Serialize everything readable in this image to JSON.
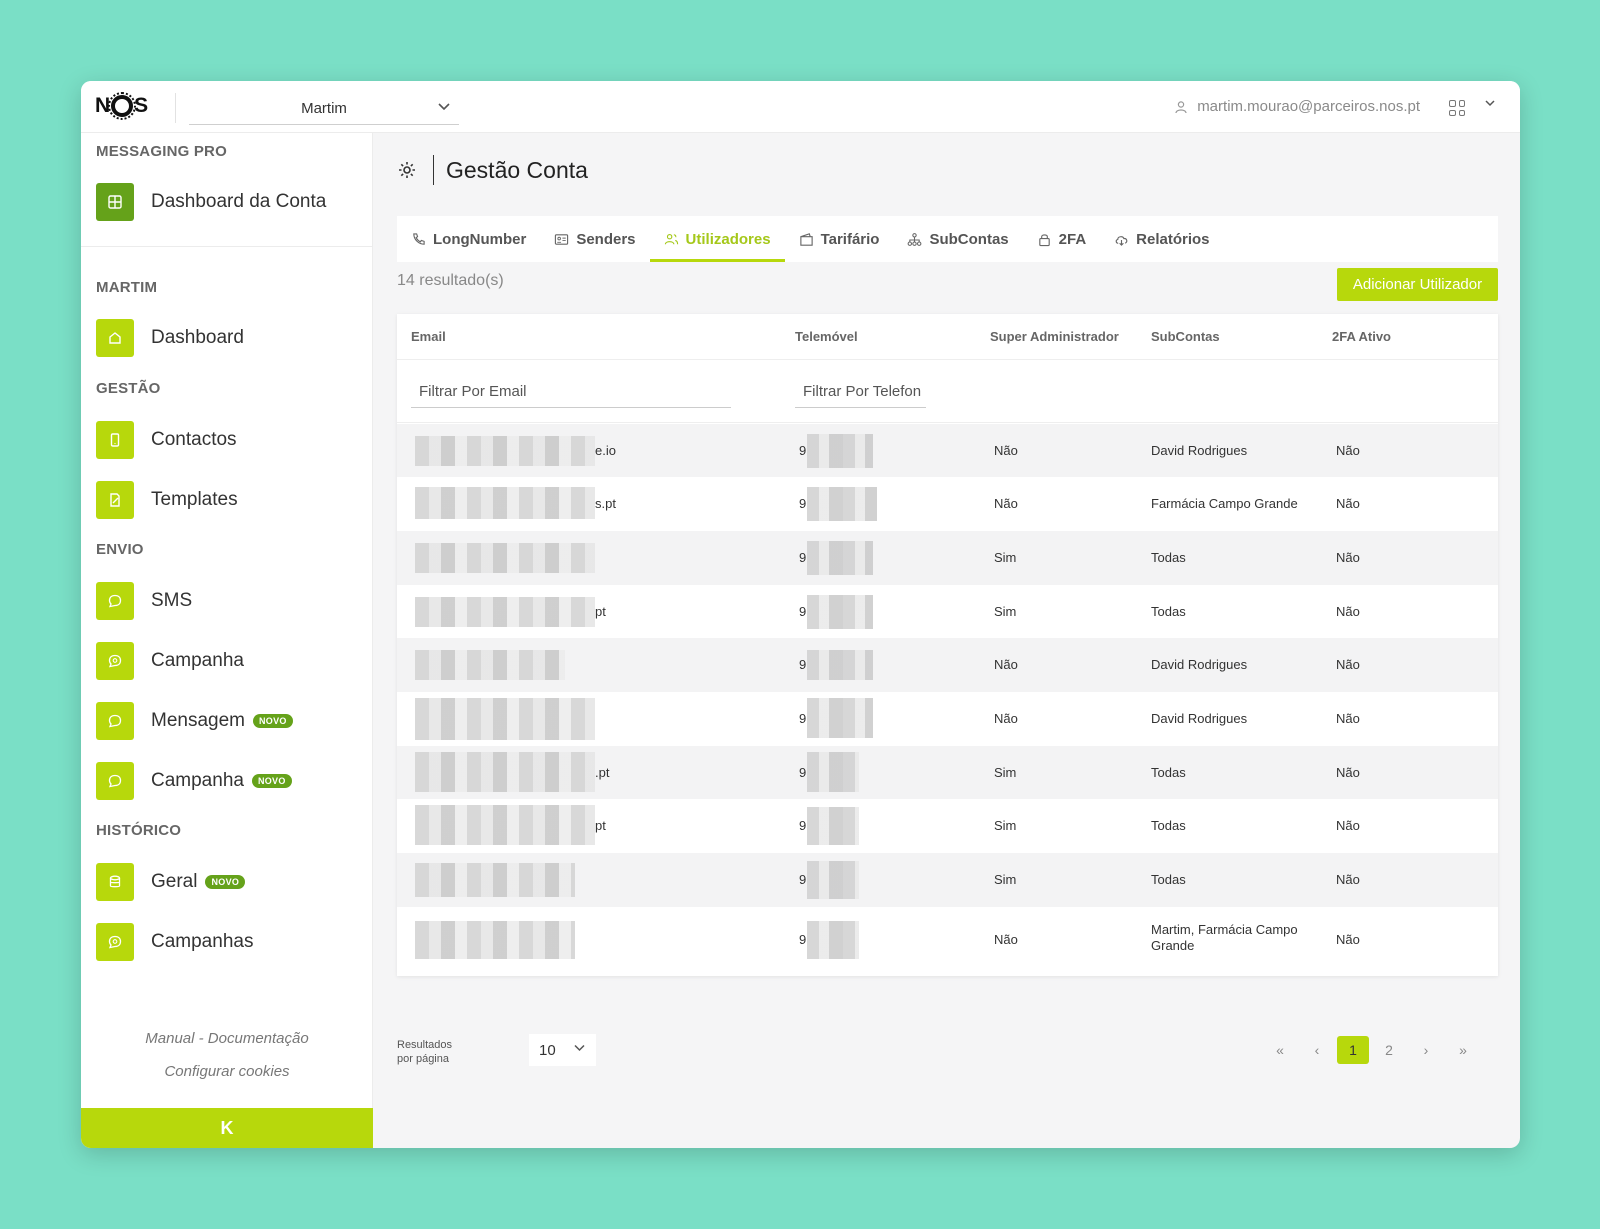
{
  "header": {
    "logo": "NOS",
    "account": "Martim",
    "user_email": "martim.mourao@parceiros.nos.pt"
  },
  "sidebar": {
    "brand_section": "MESSAGING PRO",
    "dashboard_conta": "Dashboard da Conta",
    "account_section": "MARTIM",
    "dashboard": "Dashboard",
    "gestao_section": "GESTÃO",
    "contactos": "Contactos",
    "templates": "Templates",
    "envio_section": "ENVIO",
    "sms": "SMS",
    "campanha": "Campanha",
    "mensagem": "Mensagem",
    "campanha_novo": "Campanha",
    "historico_section": "HISTÓRICO",
    "geral": "Geral",
    "campanhas": "Campanhas",
    "badge_new": "NOVO",
    "manual_link": "Manual - Documentação",
    "cookies_link": "Configurar cookies",
    "collapse_label": "K"
  },
  "page": {
    "title": "Gestão Conta",
    "tabs": [
      {
        "label": "LongNumber"
      },
      {
        "label": "Senders"
      },
      {
        "label": "Utilizadores"
      },
      {
        "label": "Tarifário"
      },
      {
        "label": "SubContas"
      },
      {
        "label": "2FA"
      },
      {
        "label": "Relatórios"
      }
    ],
    "results": "14 resultado(s)",
    "add_button": "Adicionar Utilizador"
  },
  "table": {
    "headers": {
      "email": "Email",
      "phone": "Telemóvel",
      "super_admin": "Super Administrador",
      "subcontas": "SubContas",
      "twofa": "2FA Ativo"
    },
    "filter_email_placeholder": "Filtrar Por Email",
    "filter_phone_placeholder": "Filtrar Por Telefon",
    "rows": [
      {
        "email_tail": "e.io",
        "phone_head": "9",
        "admin": "Não",
        "subcontas": "David Rodrigues",
        "twofa": "Não"
      },
      {
        "email_tail": "s.pt",
        "phone_head": "9",
        "admin": "Não",
        "subcontas": "Farmácia Campo Grande",
        "twofa": "Não"
      },
      {
        "email_tail": "",
        "phone_head": "9",
        "admin": "Sim",
        "subcontas": "Todas",
        "twofa": "Não"
      },
      {
        "email_tail": "pt",
        "phone_head": "9",
        "admin": "Sim",
        "subcontas": "Todas",
        "twofa": "Não"
      },
      {
        "email_tail": "",
        "phone_head": "9",
        "admin": "Não",
        "subcontas": "David Rodrigues",
        "twofa": "Não"
      },
      {
        "email_tail": "",
        "phone_head": "9",
        "admin": "Não",
        "subcontas": "David Rodrigues",
        "twofa": "Não"
      },
      {
        "email_tail": ".pt",
        "phone_head": "9",
        "admin": "Sim",
        "subcontas": "Todas",
        "twofa": "Não"
      },
      {
        "email_tail": "pt",
        "phone_head": "9",
        "admin": "Sim",
        "subcontas": "Todas",
        "twofa": "Não"
      },
      {
        "email_tail": "",
        "phone_head": "9",
        "admin": "Sim",
        "subcontas": "Todas",
        "twofa": "Não"
      },
      {
        "email_tail": "",
        "phone_head": "9",
        "admin": "Não",
        "subcontas": "Martim, Farmácia Campo Grande",
        "twofa": "Não"
      }
    ]
  },
  "pagination": {
    "per_page_label": "Resultados por página",
    "per_page": "10",
    "first": "«",
    "prev": "‹",
    "pages": [
      "1",
      "2"
    ],
    "current": "1",
    "next": "›",
    "last": "»"
  },
  "colors": {
    "accent": "#b7d80c",
    "accent_dark": "#65a21a",
    "background": "#7adfc6"
  }
}
